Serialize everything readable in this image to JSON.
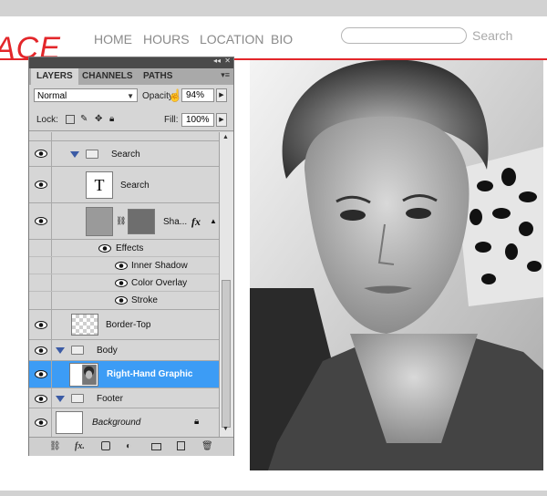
{
  "website": {
    "logo_text": "ACE",
    "nav": [
      "HOME",
      "HOURS",
      "LOCATION",
      "BIO"
    ],
    "search_placeholder": "Search"
  },
  "layers_panel": {
    "tabs": [
      "LAYERS",
      "CHANNELS",
      "PATHS"
    ],
    "active_tab": "LAYERS",
    "blend_mode": "Normal",
    "opacity_label": "Opacity:",
    "opacity_value": "94%",
    "lock_label": "Lock:",
    "fill_label": "Fill:",
    "fill_value": "100%",
    "layers": [
      {
        "name": "Search",
        "type": "group"
      },
      {
        "name": "Search",
        "type": "text",
        "thumb_glyph": "T"
      },
      {
        "name": "Sha...",
        "type": "shape",
        "fx": "fx"
      },
      {
        "name": "Effects",
        "type": "effects-header"
      },
      {
        "name": "Inner Shadow",
        "type": "effect"
      },
      {
        "name": "Color Overlay",
        "type": "effect"
      },
      {
        "name": "Stroke",
        "type": "effect"
      },
      {
        "name": "Border-Top",
        "type": "pixel"
      },
      {
        "name": "Body",
        "type": "group"
      },
      {
        "name": "Right-Hand Graphic",
        "type": "pixel",
        "selected": true
      },
      {
        "name": "Footer",
        "type": "group"
      },
      {
        "name": "Background",
        "type": "background",
        "locked": true
      }
    ]
  },
  "colors": {
    "accent_red": "#e3262a",
    "selection_blue": "#3c9cf5",
    "panel_gray": "#d6d6d6"
  }
}
